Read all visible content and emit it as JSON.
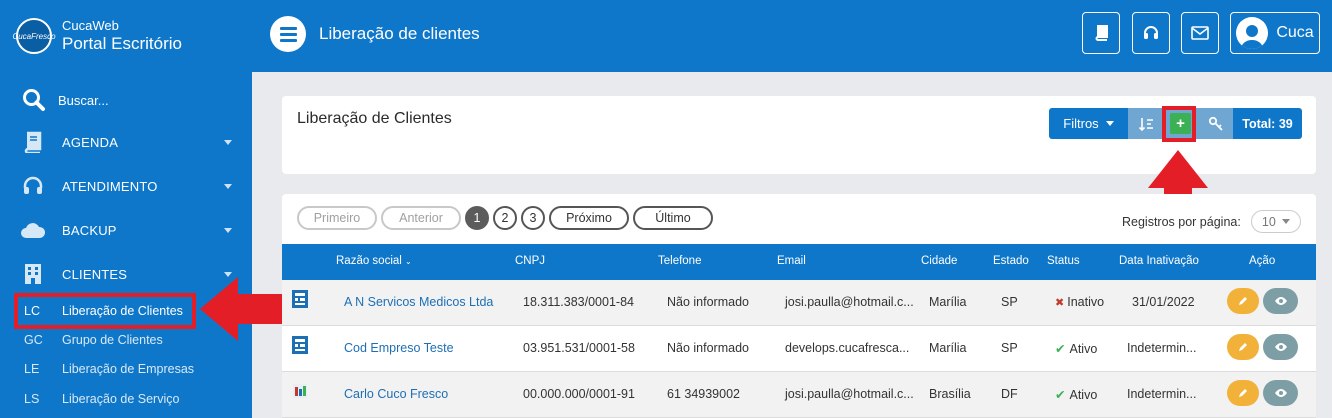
{
  "brand": {
    "logo_text": "CucaFresco",
    "app_small": "CucaWeb",
    "app_name": "Portal Escritório"
  },
  "sidebar": {
    "search_placeholder": "Buscar...",
    "items": [
      {
        "label": "AGENDA",
        "icon": "book-icon"
      },
      {
        "label": "ATENDIMENTO",
        "icon": "headset-icon"
      },
      {
        "label": "BACKUP",
        "icon": "cloud-icon"
      },
      {
        "label": "CLIENTES",
        "icon": "building-icon"
      }
    ],
    "subitems": [
      {
        "abbr": "LC",
        "label": "Liberação de Clientes",
        "active": true
      },
      {
        "abbr": "GC",
        "label": "Grupo de Clientes"
      },
      {
        "abbr": "LE",
        "label": "Liberação de Empresas"
      },
      {
        "abbr": "LS",
        "label": "Liberação de Serviço"
      }
    ]
  },
  "topbar": {
    "title": "Liberação de clientes",
    "user_name": "Cuca"
  },
  "panel": {
    "title": "Liberação de Clientes",
    "filter_label": "Filtros",
    "total_label": "Total: 39"
  },
  "pagination": {
    "first": "Primeiro",
    "prev": "Anterior",
    "pages": [
      "1",
      "2",
      "3"
    ],
    "current_page": "1",
    "next": "Próximo",
    "last": "Último",
    "per_page_label": "Registros por página:",
    "per_page_value": "10"
  },
  "table": {
    "headers": [
      "Razão social",
      "CNPJ",
      "Telefone",
      "Email",
      "Cidade",
      "Estado",
      "Status",
      "Data Inativação",
      "Ação"
    ],
    "rows": [
      {
        "razao": "A N Servicos Medicos Ltda",
        "cnpj": "18.311.383/0001-84",
        "telefone": "Não informado",
        "email": "josi.paulla@hotmail.c...",
        "cidade": "Marília",
        "estado": "SP",
        "status": "Inativo",
        "data": "31/01/2022"
      },
      {
        "razao": "Cod Empreso Teste",
        "cnpj": "03.951.531/0001-58",
        "telefone": "Não informado",
        "email": "develops.cucafresca...",
        "cidade": "Marília",
        "estado": "SP",
        "status": "Ativo",
        "data": "Indetermin..."
      },
      {
        "razao": "Carlo Cuco Fresco",
        "cnpj": "00.000.000/0001-91",
        "telefone": "61 34939002",
        "email": "josi.paulla@hotmail.c...",
        "cidade": "Brasília",
        "estado": "DF",
        "status": "Ativo",
        "data": "Indetermin..."
      }
    ]
  },
  "colors": {
    "primary": "#0f77c9",
    "add_green": "#3cb054",
    "highlight_red": "#e41e26",
    "edit_orange": "#f2b23a",
    "view_gray": "#7d9ea5"
  }
}
